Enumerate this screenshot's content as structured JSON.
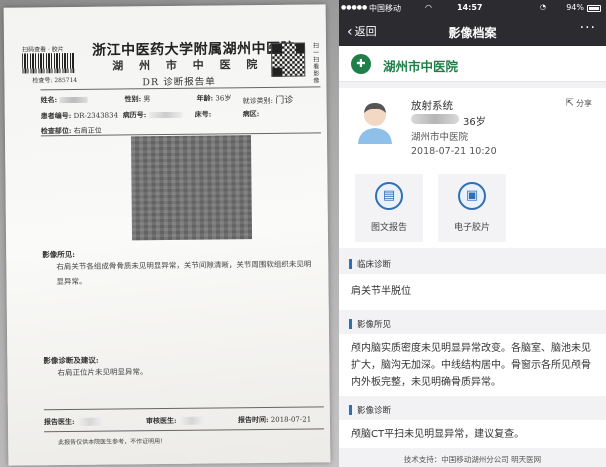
{
  "paper": {
    "barcode_label": "扫码查看 · 胶片",
    "barcode_number": "检查号: 285714",
    "hospital_title": "浙江中医药大学附属湖州中医院",
    "hospital_sub": "湖 州 市 中 医 院",
    "report_title": "DR 诊断报告单",
    "side_label": "扫一扫看影像",
    "fields": {
      "name_label": "姓名:",
      "gender_label": "性别:",
      "gender_value": "男",
      "age_label": "年龄:",
      "age_value": "36岁",
      "visit_label": "就诊类别:",
      "visit_value": "门诊",
      "patient_no_label": "患者编号:",
      "patient_no_value": "DR-2343834",
      "ward_no_label": "病历号:",
      "bed_label": "床号:",
      "area_label": "病区:",
      "exam_label": "检查部位:",
      "exam_value": "右肩正位"
    },
    "findings_heading": "影像所见:",
    "findings_text": "右肩关节各组成骨骨质未见明显异常，关节间隙清晰，关节周围软组织未见明显异常。",
    "diagnosis_heading": "影像诊断及建议:",
    "diagnosis_text": "右肩正位片未见明显异常。",
    "report_doctor_label": "报告医生:",
    "review_doctor_label": "审核医生:",
    "report_time_label": "报告时间:",
    "report_time_value": "2018-07-21",
    "footnote": "此报告仅供本院医生参考，不作证明用！"
  },
  "status_bar": {
    "carrier": "中国移动",
    "time": "14:57",
    "battery": "94%"
  },
  "nav": {
    "back_label": "返回",
    "title": "影像档案",
    "more_label": "···"
  },
  "hospital": {
    "name": "湖州市中医院"
  },
  "patient": {
    "system": "放射系统",
    "age": "36岁",
    "hospital": "湖州市中医院",
    "datetime": "2018-07-21 10:20",
    "share_label": "分享"
  },
  "tiles": [
    {
      "label": "图文报告"
    },
    {
      "label": "电子胶片"
    }
  ],
  "sections": [
    {
      "heading": "临床诊断",
      "body": "肩关节半脱位"
    },
    {
      "heading": "影像所见",
      "body": "颅内脑实质密度未见明显异常改变。各脑室、脑池未见扩大，脑沟无加深。中线结构居中。骨窗示各所见颅骨内外板完整，未见明确骨质异常。"
    },
    {
      "heading": "影像诊断",
      "body": "颅脑CT平扫未见明显异常，建议复查。"
    }
  ],
  "footer": {
    "support": "技术支持：中国移动湖州分公司 明天医网"
  },
  "colors": {
    "brand_green": "#1f7f48",
    "accent_blue": "#2f6fb7",
    "nav_dark": "#2c2c30"
  }
}
